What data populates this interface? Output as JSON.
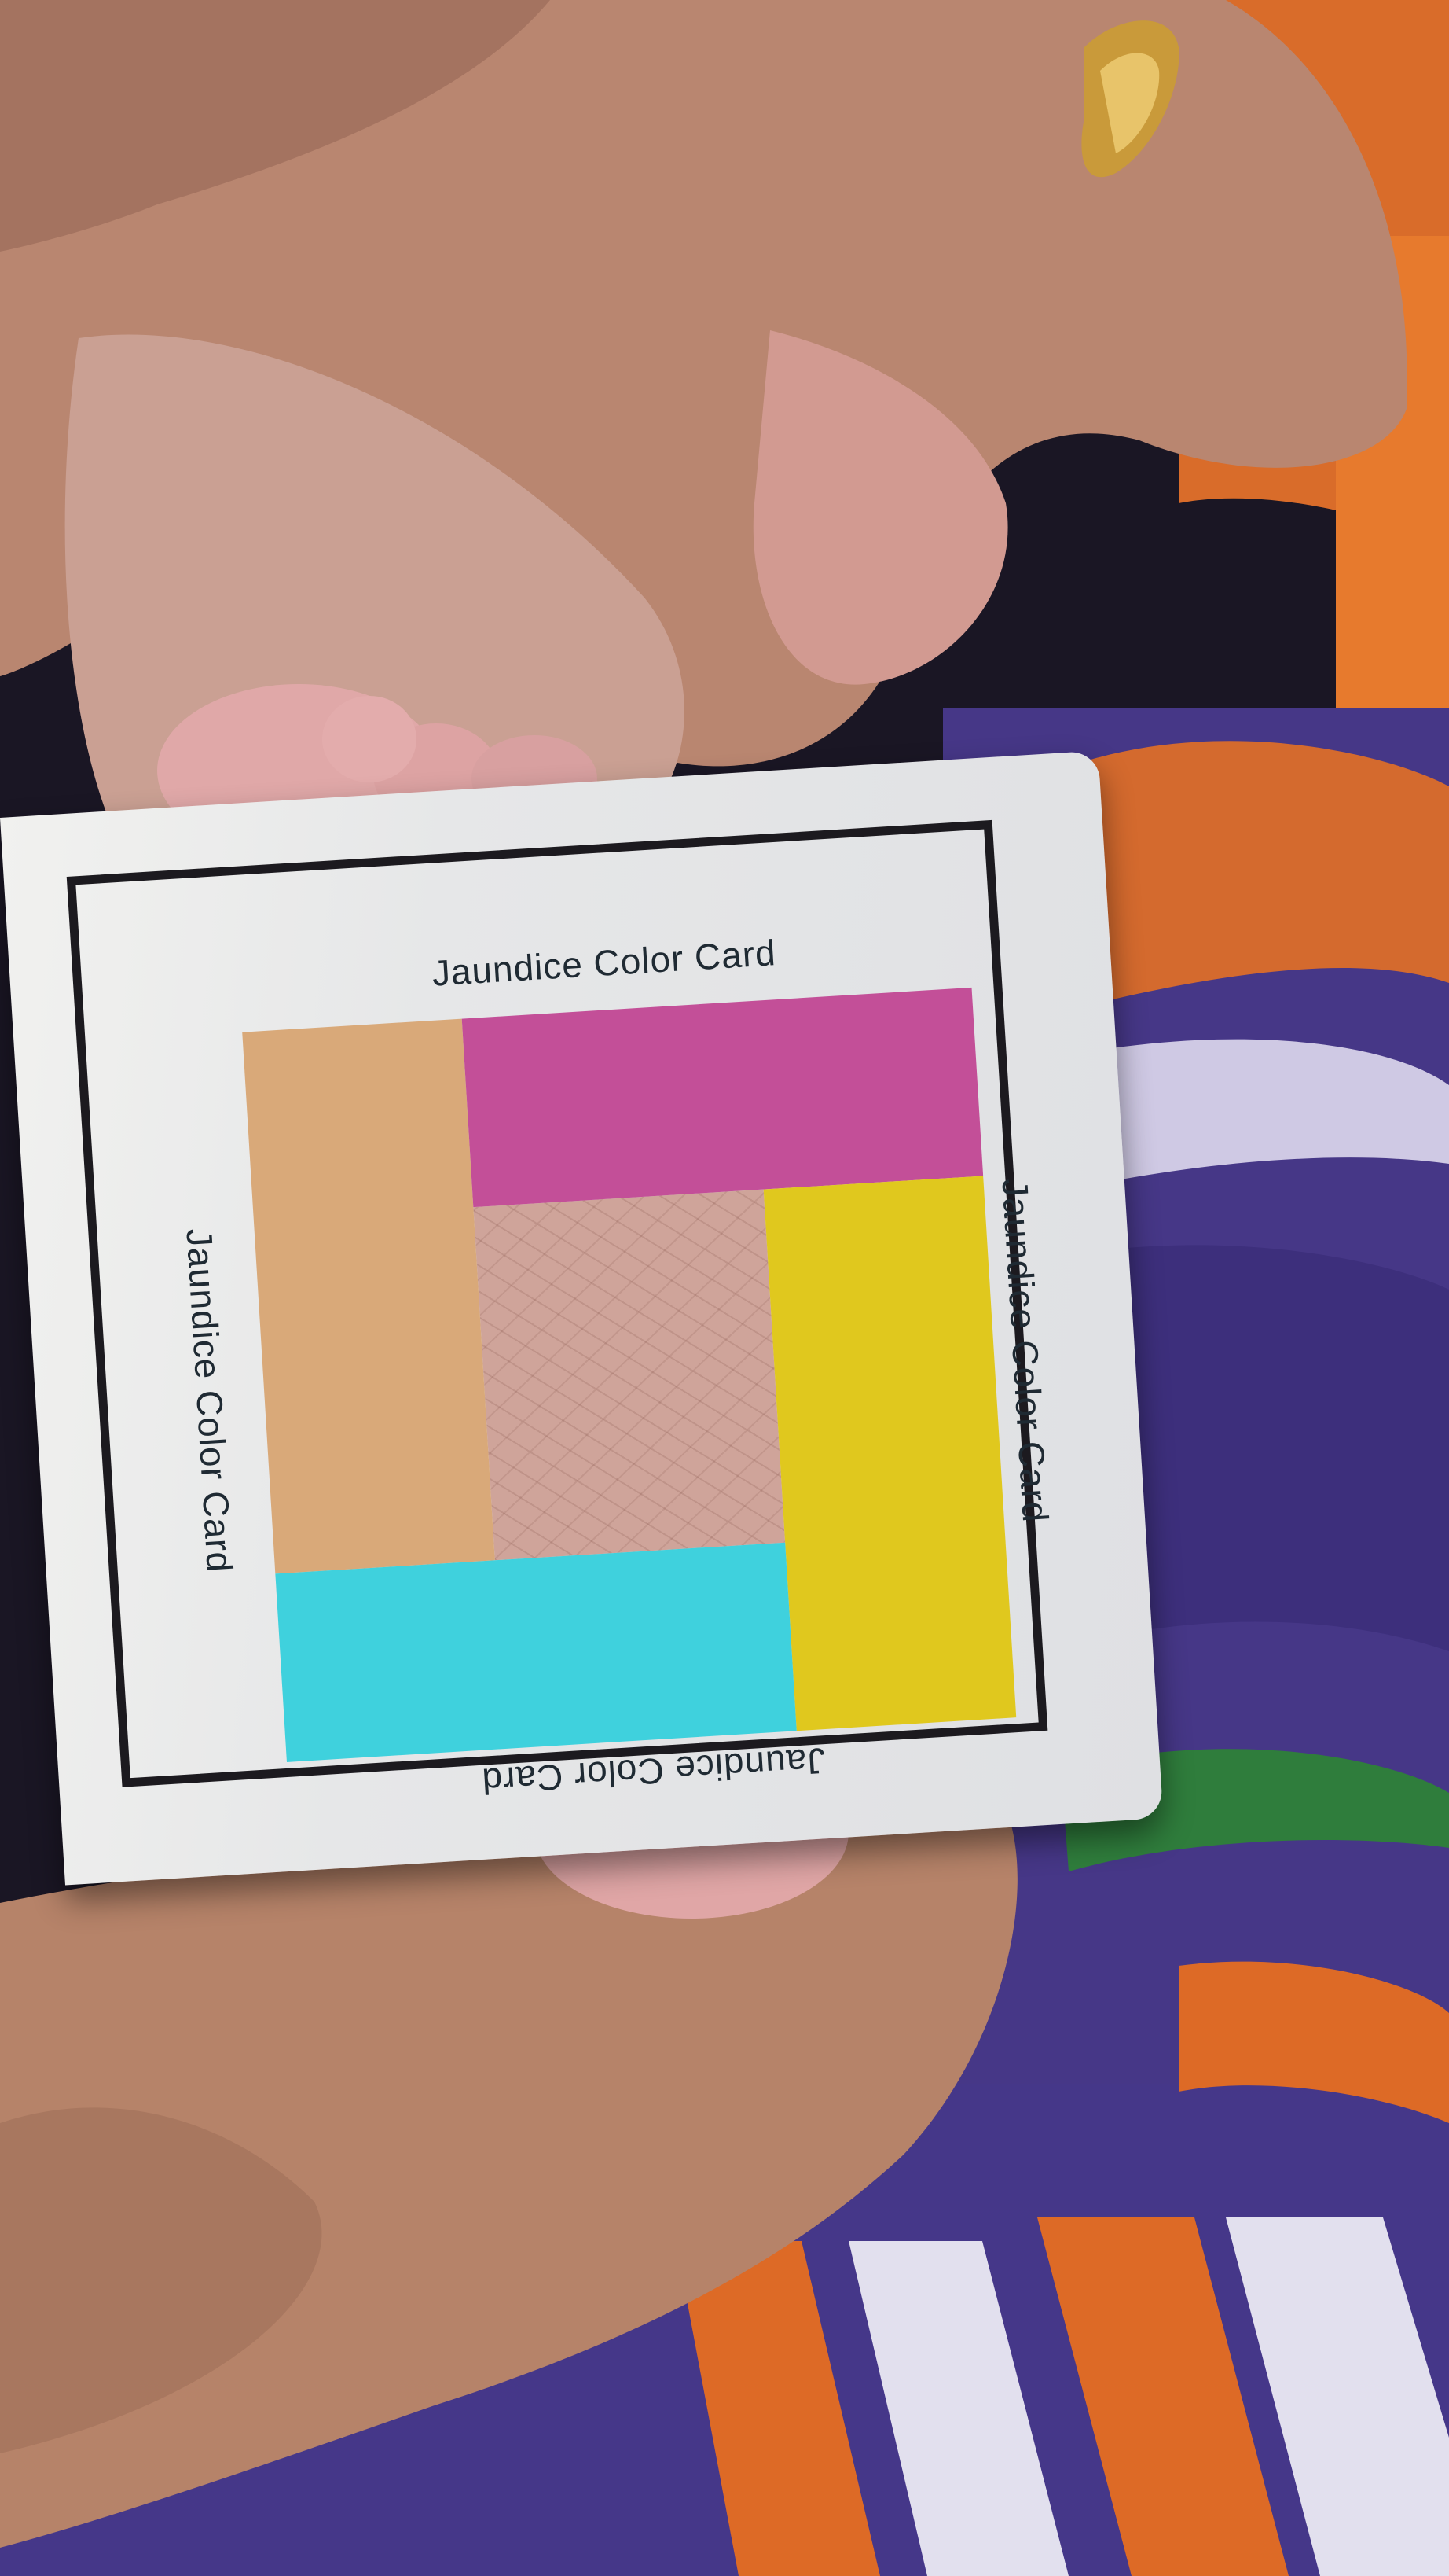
{
  "card": {
    "label_top": "Jaundice Color Card",
    "label_right": "Jaundice Color Card",
    "label_bottom": "Jaundice Color Card",
    "label_left": "Jaundice Color Card"
  },
  "colors": {
    "strip_peach": "#d9a979",
    "strip_magenta": "#c34f98",
    "strip_yellow": "#e0c81e",
    "strip_cyan": "#3fd1dd",
    "blanket_purple": "#4b3a8c",
    "blanket_orange": "#d9682b"
  }
}
